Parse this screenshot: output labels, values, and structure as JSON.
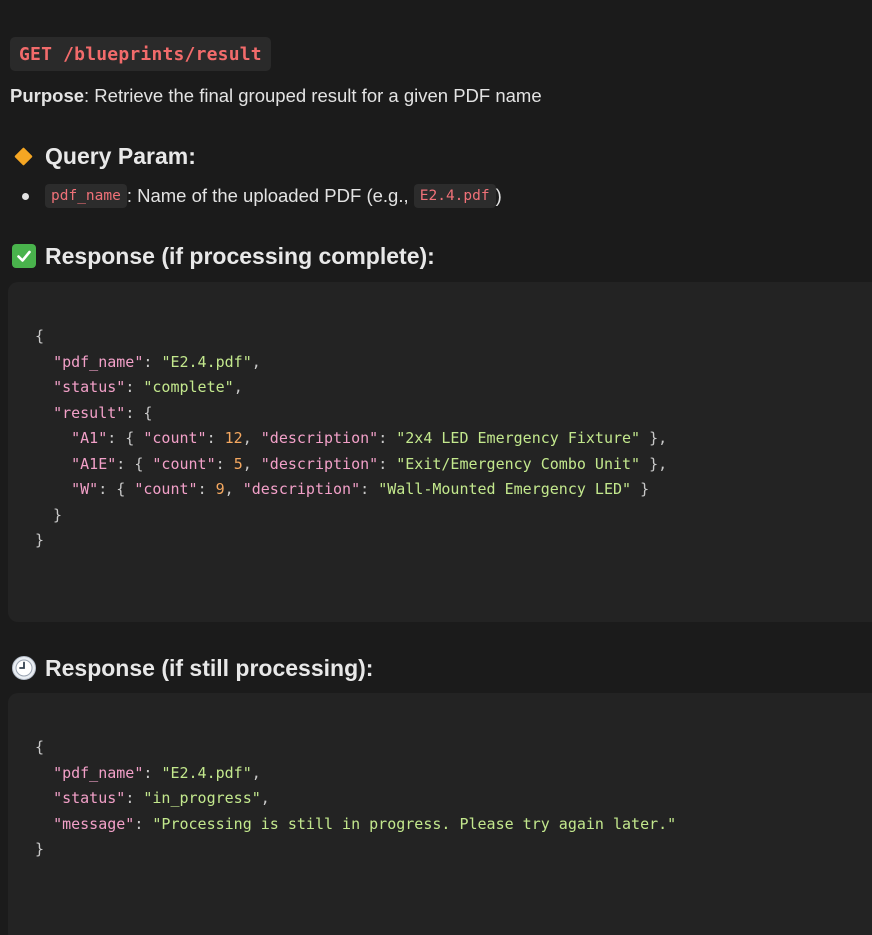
{
  "endpoint": {
    "label": "GET /blueprints/result"
  },
  "purpose": {
    "label": "Purpose",
    "text": ": Retrieve the final grouped result for a given PDF name"
  },
  "query_param": {
    "heading": "Query Param:",
    "param_name": "pdf_name",
    "param_desc": ": Name of the uploaded PDF (e.g., ",
    "example": "E2.4.pdf",
    "close": ")"
  },
  "response_complete": {
    "heading": "Response (if processing complete):",
    "lines": [
      [
        {
          "t": "p",
          "v": "{"
        }
      ],
      [
        {
          "t": "p",
          "v": "  "
        },
        {
          "t": "k",
          "v": "\"pdf_name\""
        },
        {
          "t": "p",
          "v": ": "
        },
        {
          "t": "s",
          "v": "\"E2.4.pdf\""
        },
        {
          "t": "p",
          "v": ","
        }
      ],
      [
        {
          "t": "p",
          "v": "  "
        },
        {
          "t": "k",
          "v": "\"status\""
        },
        {
          "t": "p",
          "v": ": "
        },
        {
          "t": "s",
          "v": "\"complete\""
        },
        {
          "t": "p",
          "v": ","
        }
      ],
      [
        {
          "t": "p",
          "v": "  "
        },
        {
          "t": "k",
          "v": "\"result\""
        },
        {
          "t": "p",
          "v": ": {"
        }
      ],
      [
        {
          "t": "p",
          "v": "    "
        },
        {
          "t": "k",
          "v": "\"A1\""
        },
        {
          "t": "p",
          "v": ": { "
        },
        {
          "t": "k",
          "v": "\"count\""
        },
        {
          "t": "p",
          "v": ": "
        },
        {
          "t": "n",
          "v": "12"
        },
        {
          "t": "p",
          "v": ", "
        },
        {
          "t": "k",
          "v": "\"description\""
        },
        {
          "t": "p",
          "v": ": "
        },
        {
          "t": "s",
          "v": "\"2x4 LED Emergency Fixture\""
        },
        {
          "t": "p",
          "v": " },"
        }
      ],
      [
        {
          "t": "p",
          "v": "    "
        },
        {
          "t": "k",
          "v": "\"A1E\""
        },
        {
          "t": "p",
          "v": ": { "
        },
        {
          "t": "k",
          "v": "\"count\""
        },
        {
          "t": "p",
          "v": ": "
        },
        {
          "t": "n",
          "v": "5"
        },
        {
          "t": "p",
          "v": ", "
        },
        {
          "t": "k",
          "v": "\"description\""
        },
        {
          "t": "p",
          "v": ": "
        },
        {
          "t": "s",
          "v": "\"Exit/Emergency Combo Unit\""
        },
        {
          "t": "p",
          "v": " },"
        }
      ],
      [
        {
          "t": "p",
          "v": "    "
        },
        {
          "t": "k",
          "v": "\"W\""
        },
        {
          "t": "p",
          "v": ": { "
        },
        {
          "t": "k",
          "v": "\"count\""
        },
        {
          "t": "p",
          "v": ": "
        },
        {
          "t": "n",
          "v": "9"
        },
        {
          "t": "p",
          "v": ", "
        },
        {
          "t": "k",
          "v": "\"description\""
        },
        {
          "t": "p",
          "v": ": "
        },
        {
          "t": "s",
          "v": "\"Wall-Mounted Emergency LED\""
        },
        {
          "t": "p",
          "v": " }"
        }
      ],
      [
        {
          "t": "p",
          "v": "  }"
        }
      ],
      [
        {
          "t": "p",
          "v": "}"
        }
      ]
    ]
  },
  "response_progress": {
    "heading": "Response (if still processing):",
    "lines": [
      [
        {
          "t": "p",
          "v": "{"
        }
      ],
      [
        {
          "t": "p",
          "v": "  "
        },
        {
          "t": "k",
          "v": "\"pdf_name\""
        },
        {
          "t": "p",
          "v": ": "
        },
        {
          "t": "s",
          "v": "\"E2.4.pdf\""
        },
        {
          "t": "p",
          "v": ","
        }
      ],
      [
        {
          "t": "p",
          "v": "  "
        },
        {
          "t": "k",
          "v": "\"status\""
        },
        {
          "t": "p",
          "v": ": "
        },
        {
          "t": "s",
          "v": "\"in_progress\""
        },
        {
          "t": "p",
          "v": ","
        }
      ],
      [
        {
          "t": "p",
          "v": "  "
        },
        {
          "t": "k",
          "v": "\"message\""
        },
        {
          "t": "p",
          "v": ": "
        },
        {
          "t": "s",
          "v": "\"Processing is still in progress. Please try again later.\""
        }
      ],
      [
        {
          "t": "p",
          "v": "}"
        }
      ]
    ]
  },
  "colors": {
    "background": "#1b1b1b",
    "code_bg": "#232323",
    "endpoint_text": "#f26b6b",
    "json_key": "#f2a0c8",
    "json_string": "#c3e88d",
    "json_number": "#f5a860"
  }
}
